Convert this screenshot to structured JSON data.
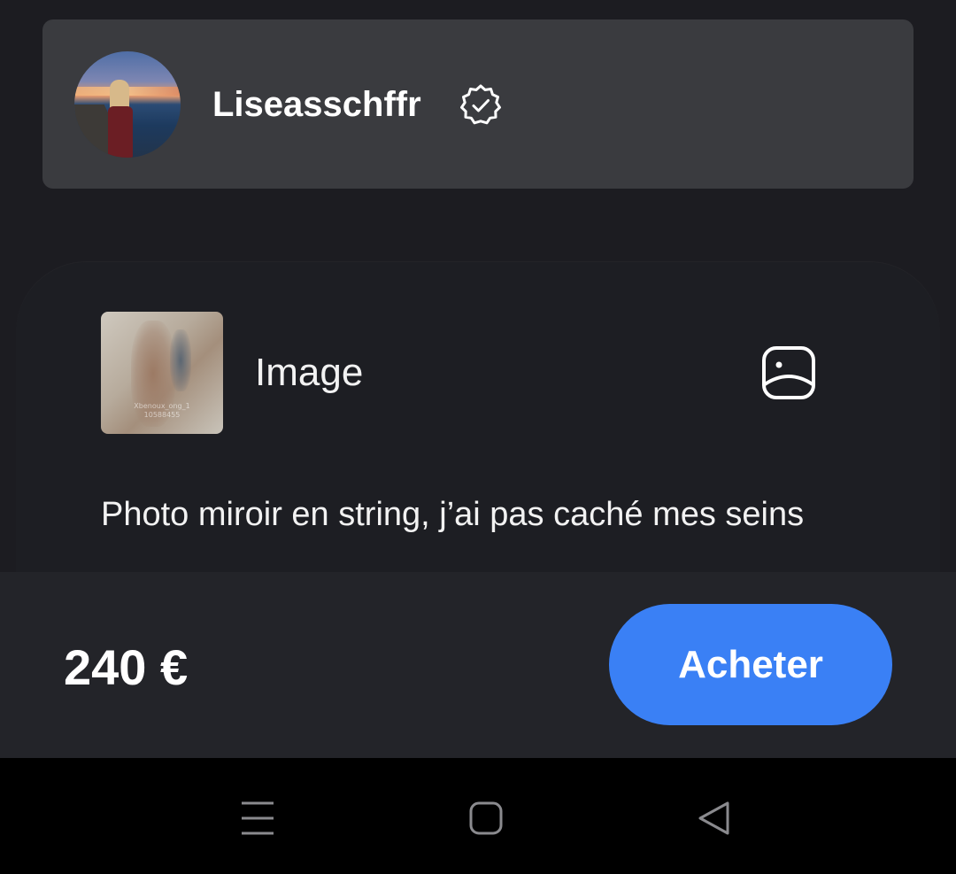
{
  "creator": {
    "name": "Liseasschffr",
    "verified_icon": "verified-badge-icon"
  },
  "media": {
    "thumbnail_watermark_line1": "Xbenoux_ong_1",
    "thumbnail_watermark_line2": "10588455",
    "type_label": "Image",
    "type_icon": "image-icon",
    "description": "Photo miroir en string, j’ai pas caché mes seins"
  },
  "purchase": {
    "price": "240 €",
    "buy_label": "Acheter",
    "button_color": "#3a80f5"
  },
  "navigation": {
    "menu_icon": "menu-icon",
    "home_icon": "home-icon",
    "back_icon": "back-icon"
  },
  "colors": {
    "background": "#1c1c21",
    "card": "#3a3b3f",
    "purchase_bar": "#232429",
    "nav_bar": "#000000"
  }
}
